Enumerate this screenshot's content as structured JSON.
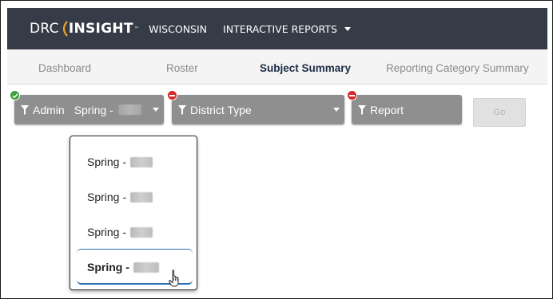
{
  "header": {
    "logo_left": "DRC",
    "logo_right": "INSIGHT",
    "trademark": "™",
    "state": "WISCONSIN",
    "menu_label": "INTERACTIVE REPORTS"
  },
  "nav": {
    "tabs": [
      {
        "label": "Dashboard",
        "active": false
      },
      {
        "label": "Roster",
        "active": false
      },
      {
        "label": "Subject Summary",
        "active": true
      },
      {
        "label": "Reporting Category Summary",
        "active": false
      }
    ]
  },
  "filters": {
    "admin": {
      "label": "Admin",
      "value": "Spring -",
      "status": "selected"
    },
    "district_type": {
      "label": "District Type",
      "status": "required"
    },
    "report": {
      "label": "Report",
      "status": "required"
    },
    "go_label": "Go"
  },
  "dropdown": {
    "options": [
      "Spring -",
      "Spring -",
      "Spring -",
      "Spring -"
    ],
    "hovered_index": 3
  },
  "colors": {
    "header_bg": "#363c47",
    "nav_bg": "#f4f4f4",
    "filter_bg": "#8f8f8f",
    "ok_badge": "#3aa03a",
    "error_badge": "#d42a2a",
    "active_tab_text": "#1c2b45",
    "selection_outline": "#2a6fb3"
  },
  "icons": {
    "filter": "funnel-icon",
    "menu_caret": "caret-down-icon",
    "ok": "check-badge-icon",
    "error": "minus-badge-icon",
    "cursor": "hand-pointer-icon"
  }
}
